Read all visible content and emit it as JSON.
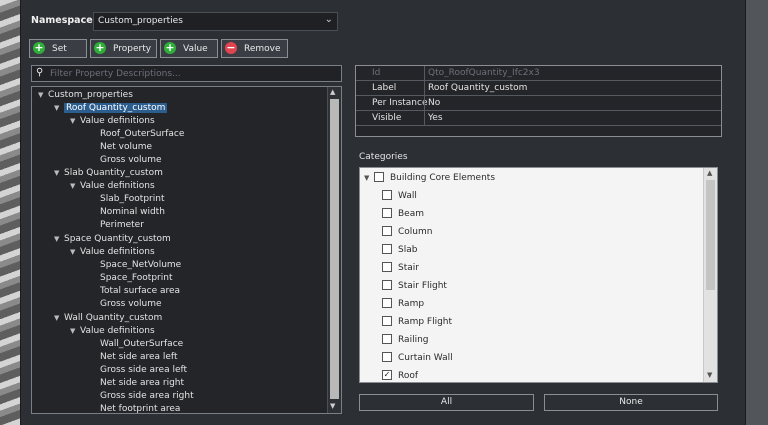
{
  "namespace": {
    "label": "Namespace:",
    "value": "Custom_properties"
  },
  "toolbar": {
    "set": "Set",
    "property": "Property",
    "value": "Value",
    "remove": "Remove"
  },
  "filter": {
    "placeholder": "Filter Property Descriptions..."
  },
  "tree": {
    "root": "Custom_properties",
    "nodes": [
      "Roof Quantity_custom",
      "Value definitions",
      "Roof_OuterSurface",
      "Net volume",
      "Gross volume",
      "Slab Quantity_custom",
      "Value definitions",
      "Slab_Footprint",
      "Nominal width",
      "Perimeter",
      "Space Quantity_custom",
      "Value definitions",
      "Space_NetVolume",
      "Space_Footprint",
      "Total surface area",
      "Gross volume",
      "Wall Quantity_custom",
      "Value definitions",
      "Wall_OuterSurface",
      "Net side area left",
      "Gross side area left",
      "Net side area right",
      "Gross side area right",
      "Net footprint area"
    ]
  },
  "properties": [
    {
      "key": "Id",
      "value": "Qto_RoofQuantity_Ifc2x3"
    },
    {
      "key": "Label",
      "value": "Roof Quantity_custom"
    },
    {
      "key": "Per Instance",
      "value": "No"
    },
    {
      "key": "Visible",
      "value": "Yes"
    }
  ],
  "categories": {
    "title": "Categories",
    "root": "Building Core Elements",
    "items": [
      {
        "label": "Wall",
        "checked": false
      },
      {
        "label": "Beam",
        "checked": false
      },
      {
        "label": "Column",
        "checked": false
      },
      {
        "label": "Slab",
        "checked": false
      },
      {
        "label": "Stair",
        "checked": false
      },
      {
        "label": "Stair Flight",
        "checked": false
      },
      {
        "label": "Ramp",
        "checked": false
      },
      {
        "label": "Ramp Flight",
        "checked": false
      },
      {
        "label": "Railing",
        "checked": false
      },
      {
        "label": "Curtain Wall",
        "checked": false
      },
      {
        "label": "Roof",
        "checked": true
      }
    ]
  },
  "buttons": {
    "all": "All",
    "none": "None"
  },
  "icons": {
    "add": "plus-circle-icon",
    "remove": "minus-circle-icon",
    "search": "search-icon",
    "dropdown": "chevron-down-icon",
    "expand": "triangle-down-icon"
  },
  "colors": {
    "add": "#2fae3a",
    "remove": "#e0444f",
    "selection": "#2c5d8f"
  }
}
